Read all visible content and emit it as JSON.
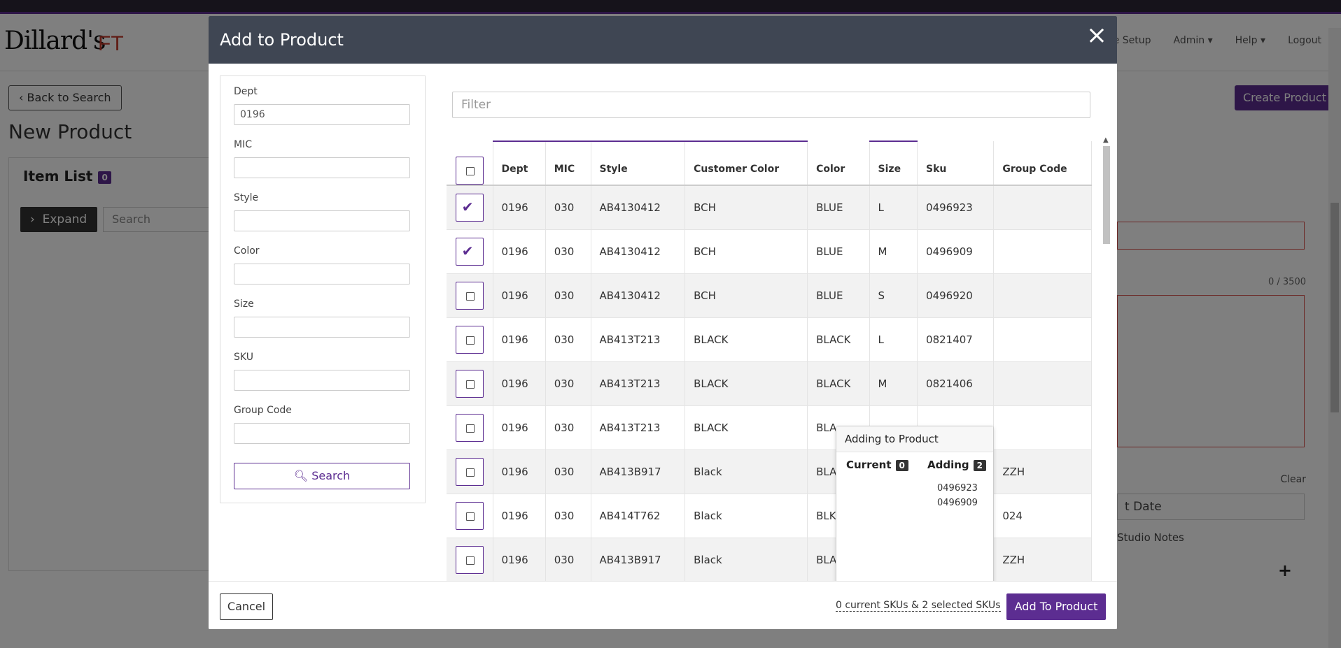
{
  "background": {
    "logo_text": "Dillard's",
    "logo_suffix": "FT",
    "nav": [
      "Style Setup",
      "Admin ▾",
      "Help ▾",
      "Logout"
    ],
    "back_button": "Back to Search",
    "page_title": "New Product",
    "create_button": "Create Product",
    "item_list": {
      "title": "Item List",
      "count": "0",
      "expand": "Expand",
      "search_placeholder": "Search"
    },
    "right_form": {
      "char_count": "0 / 3500",
      "clear": "Clear",
      "date_placeholder": "t Date",
      "notes_label": "Studio Notes",
      "add_icon": "+"
    }
  },
  "modal": {
    "title": "Add to Product",
    "close_symbol": "×",
    "form": {
      "fields": [
        {
          "label": "Dept",
          "value": "0196"
        },
        {
          "label": "MIC",
          "value": ""
        },
        {
          "label": "Style",
          "value": ""
        },
        {
          "label": "Color",
          "value": ""
        },
        {
          "label": "Size",
          "value": ""
        },
        {
          "label": "SKU",
          "value": ""
        },
        {
          "label": "Group Code",
          "value": ""
        }
      ],
      "search_button": "Search"
    },
    "filter_placeholder": "Filter",
    "table": {
      "columns": [
        "Dept",
        "MIC",
        "Style",
        "Customer Color",
        "Color",
        "Size",
        "Sku",
        "Group Code"
      ],
      "rows": [
        {
          "checked": true,
          "cells": [
            "0196",
            "030",
            "AB4130412",
            "BCH",
            "BLUE",
            "L",
            "0496923",
            ""
          ]
        },
        {
          "checked": true,
          "cells": [
            "0196",
            "030",
            "AB4130412",
            "BCH",
            "BLUE",
            "M",
            "0496909",
            ""
          ]
        },
        {
          "checked": false,
          "cells": [
            "0196",
            "030",
            "AB4130412",
            "BCH",
            "BLUE",
            "S",
            "0496920",
            ""
          ]
        },
        {
          "checked": false,
          "cells": [
            "0196",
            "030",
            "AB413T213",
            "BLACK",
            "BLACK",
            "L",
            "0821407",
            ""
          ]
        },
        {
          "checked": false,
          "cells": [
            "0196",
            "030",
            "AB413T213",
            "BLACK",
            "BLACK",
            "M",
            "0821406",
            ""
          ]
        },
        {
          "checked": false,
          "cells": [
            "0196",
            "030",
            "AB413T213",
            "BLACK",
            "BLA",
            "",
            "",
            ""
          ]
        },
        {
          "checked": false,
          "cells": [
            "0196",
            "030",
            "AB413B917",
            "Black",
            "BLA",
            "",
            "",
            "ZZH"
          ]
        },
        {
          "checked": false,
          "cells": [
            "0196",
            "030",
            "AB414T762",
            "Black",
            "BLK",
            "",
            "",
            "024"
          ]
        },
        {
          "checked": false,
          "cells": [
            "0196",
            "030",
            "AB413B917",
            "Black",
            "BLA",
            "",
            "",
            "ZZH"
          ]
        }
      ]
    },
    "popover": {
      "title": "Adding to Product",
      "current_label": "Current",
      "current_count": "0",
      "adding_label": "Adding",
      "adding_count": "2",
      "adding_skus": [
        "0496923",
        "0496909"
      ]
    },
    "footer": {
      "cancel": "Cancel",
      "summary": "0 current SKUs & 2 selected SKUs",
      "add_button": "Add To Product"
    }
  },
  "colors": {
    "accent": "#5c2d91",
    "header": "#3f4653"
  }
}
